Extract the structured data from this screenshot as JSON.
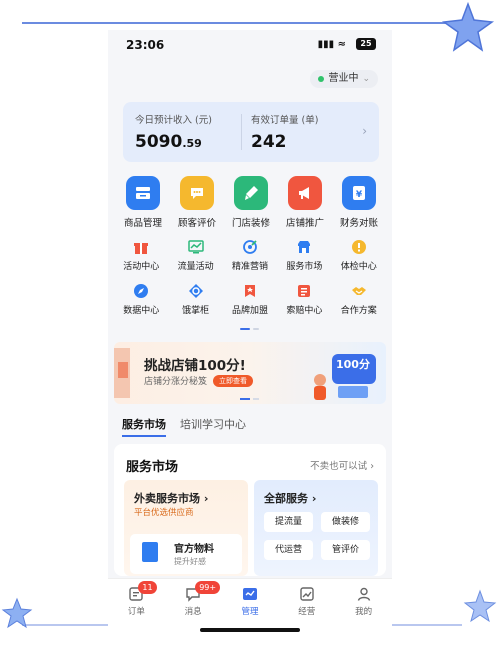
{
  "status_bar": {
    "time": "23:06",
    "signal": "▮▮▮ ≈",
    "battery": "25"
  },
  "shop_status": {
    "label": "营业中",
    "color": "#30c26b"
  },
  "income": {
    "left": {
      "label": "今日预计收入 (元)",
      "value_main": "5090",
      "value_decimal": ".59"
    },
    "right": {
      "label": "有效订单量 (单)",
      "value": "242"
    }
  },
  "main_functions": [
    {
      "label": "商品管理",
      "icon": "product-icon",
      "color": "#2f7df0"
    },
    {
      "label": "顾客评价",
      "icon": "comment-icon",
      "color": "#f5b82e"
    },
    {
      "label": "门店装修",
      "icon": "brush-icon",
      "color": "#2cb87a"
    },
    {
      "label": "店铺推广",
      "icon": "megaphone-icon",
      "color": "#f0563f"
    },
    {
      "label": "财务对账",
      "icon": "finance-icon",
      "color": "#2f7df0"
    }
  ],
  "sub_functions": [
    {
      "label": "活动中心",
      "icon": "gift-icon",
      "color": "#f0563f"
    },
    {
      "label": "流量活动",
      "icon": "chart-icon",
      "color": "#2cb87a"
    },
    {
      "label": "精准营销",
      "icon": "target-icon",
      "color": "#2f7df0"
    },
    {
      "label": "服务市场",
      "icon": "store-icon",
      "color": "#2f7df0"
    },
    {
      "label": "体检中心",
      "icon": "checkup-icon",
      "color": "#f5b82e"
    },
    {
      "label": "数据中心",
      "icon": "compass-icon",
      "color": "#2f7df0"
    },
    {
      "label": "饿掌柜",
      "icon": "eleme-icon",
      "color": "#2f7df0"
    },
    {
      "label": "品牌加盟",
      "icon": "flag-icon",
      "color": "#f0563f"
    },
    {
      "label": "索赔中心",
      "icon": "claim-icon",
      "color": "#f0563f"
    },
    {
      "label": "合作方案",
      "icon": "handshake-icon",
      "color": "#f5b82e"
    }
  ],
  "banner": {
    "title": "挑战店铺100分!",
    "subtitle": "店铺分涨分秘笈",
    "button": "立即查看",
    "badge": "100分"
  },
  "tabs": [
    {
      "label": "服务市场",
      "active": true
    },
    {
      "label": "培训学习中心",
      "active": false
    }
  ],
  "market": {
    "title": "服务市场",
    "more": "不卖也可以试 ›",
    "left_card": {
      "title": "外卖服务市场 ›",
      "subtitle": "平台优选供应商",
      "item_title": "官方物料",
      "item_sub": "提升好感"
    },
    "right_card": {
      "title": "全部服务 ›",
      "chips": [
        "提流量",
        "做装修",
        "代运营",
        "管评价"
      ]
    }
  },
  "bottom_nav": [
    {
      "label": "订单",
      "icon": "order-icon",
      "badge": "11",
      "active": false
    },
    {
      "label": "消息",
      "icon": "message-icon",
      "badge": "99+",
      "active": false
    },
    {
      "label": "管理",
      "icon": "manage-icon",
      "badge": "",
      "active": true
    },
    {
      "label": "经营",
      "icon": "business-icon",
      "badge": "",
      "active": false
    },
    {
      "label": "我的",
      "icon": "profile-icon",
      "badge": "",
      "active": false
    }
  ]
}
